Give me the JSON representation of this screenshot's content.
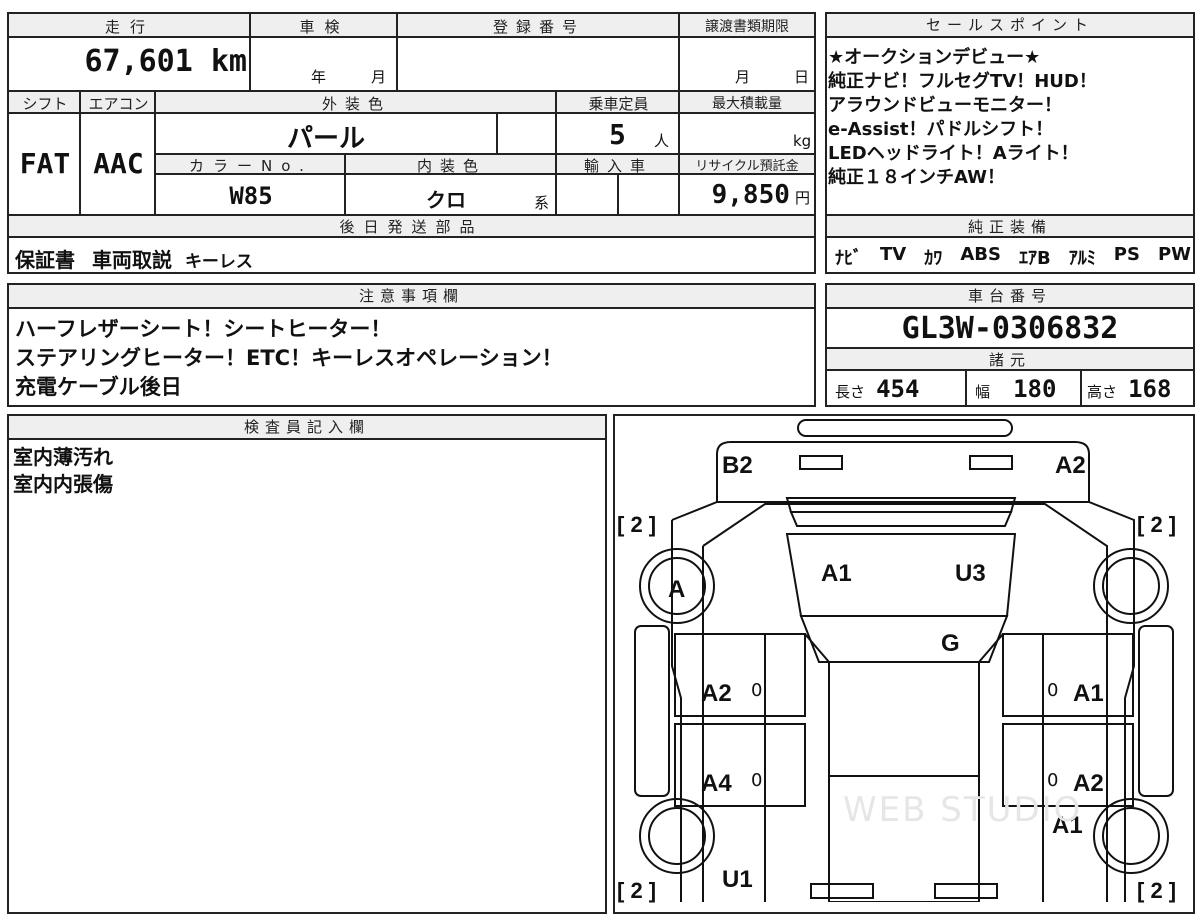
{
  "vehicle": {
    "mileage_label": "走行",
    "mileage_value": "67,601",
    "mileage_unit": "km",
    "inspection_label": "車検",
    "inspection_year_unit": "年",
    "inspection_month_unit": "月",
    "registration_label": "登録番号",
    "transfer_deadline_label": "譲渡書類期限",
    "transfer_month_unit": "月",
    "transfer_day_unit": "日",
    "shift_label": "シフト",
    "shift_value": "FAT",
    "aircon_label": "エアコン",
    "aircon_value": "AAC",
    "exterior_color_label": "外装色",
    "exterior_color_value": "パール",
    "capacity_label": "乗車定員",
    "capacity_value": "5",
    "capacity_unit": "人",
    "max_load_label": "最大積載量",
    "max_load_unit": "kg",
    "color_no_label": "カラーNo.",
    "color_no_value": "W85",
    "interior_color_label": "内装色",
    "interior_color_value": "クロ",
    "interior_color_suffix": "系",
    "import_label": "輸入車",
    "recycle_label": "リサイクル預託金",
    "recycle_value": "9,850",
    "recycle_unit": "円"
  },
  "later_parts": {
    "label": "後日発送部品",
    "items": [
      "保証書",
      "車両取説",
      "キーレス"
    ]
  },
  "sales_points": {
    "label": "セールスポイント",
    "lines": [
      "★オークションデビュー★",
      "純正ナビ！フルセグTV！HUD！",
      "アラウンドビューモニター！",
      "e-Assist！パドルシフト！",
      "LEDヘッドライト！Aライト！",
      "純正１８インチAW！"
    ]
  },
  "equipment": {
    "label": "純正装備",
    "items": [
      "ﾅﾋﾞ",
      "TV",
      "ｶﾜ",
      "ABS",
      "ｴｱB",
      "ｱﾙﾐ",
      "PS",
      "PW"
    ]
  },
  "notes": {
    "label": "注意事項欄",
    "lines": [
      "ハーフレザーシート！シートヒーター！",
      "ステアリングヒーター！ETC！キーレスオペレーション！",
      "充電ケーブル後日"
    ]
  },
  "chassis": {
    "label": "車台番号",
    "value": "GL3W-0306832"
  },
  "specs": {
    "label": "諸元",
    "length_label": "長さ",
    "length_value": "454",
    "width_label": "幅",
    "width_value": "180",
    "height_label": "高さ",
    "height_value": "168"
  },
  "inspector": {
    "label": "検査員記入欄",
    "lines": [
      "室内薄汚れ",
      "室内内張傷"
    ]
  },
  "diagram": {
    "marks": {
      "b2": "B2",
      "a2_rear": "A2",
      "a1_roof": "A1",
      "u3": "U3",
      "a_wheel": "A",
      "g": "G",
      "a2_left": "A2",
      "a1_right": "A1",
      "a4_left": "A4",
      "a2_right": "A2",
      "a1_front_right": "A1",
      "u1": "U1"
    },
    "tires": {
      "rear_left": "[ 2 ]",
      "rear_right": "[ 2 ]",
      "front_left": "[ 2 ]",
      "front_right": "[ 2 ]"
    },
    "zero": "0",
    "watermark": "WEB STUDIO"
  }
}
